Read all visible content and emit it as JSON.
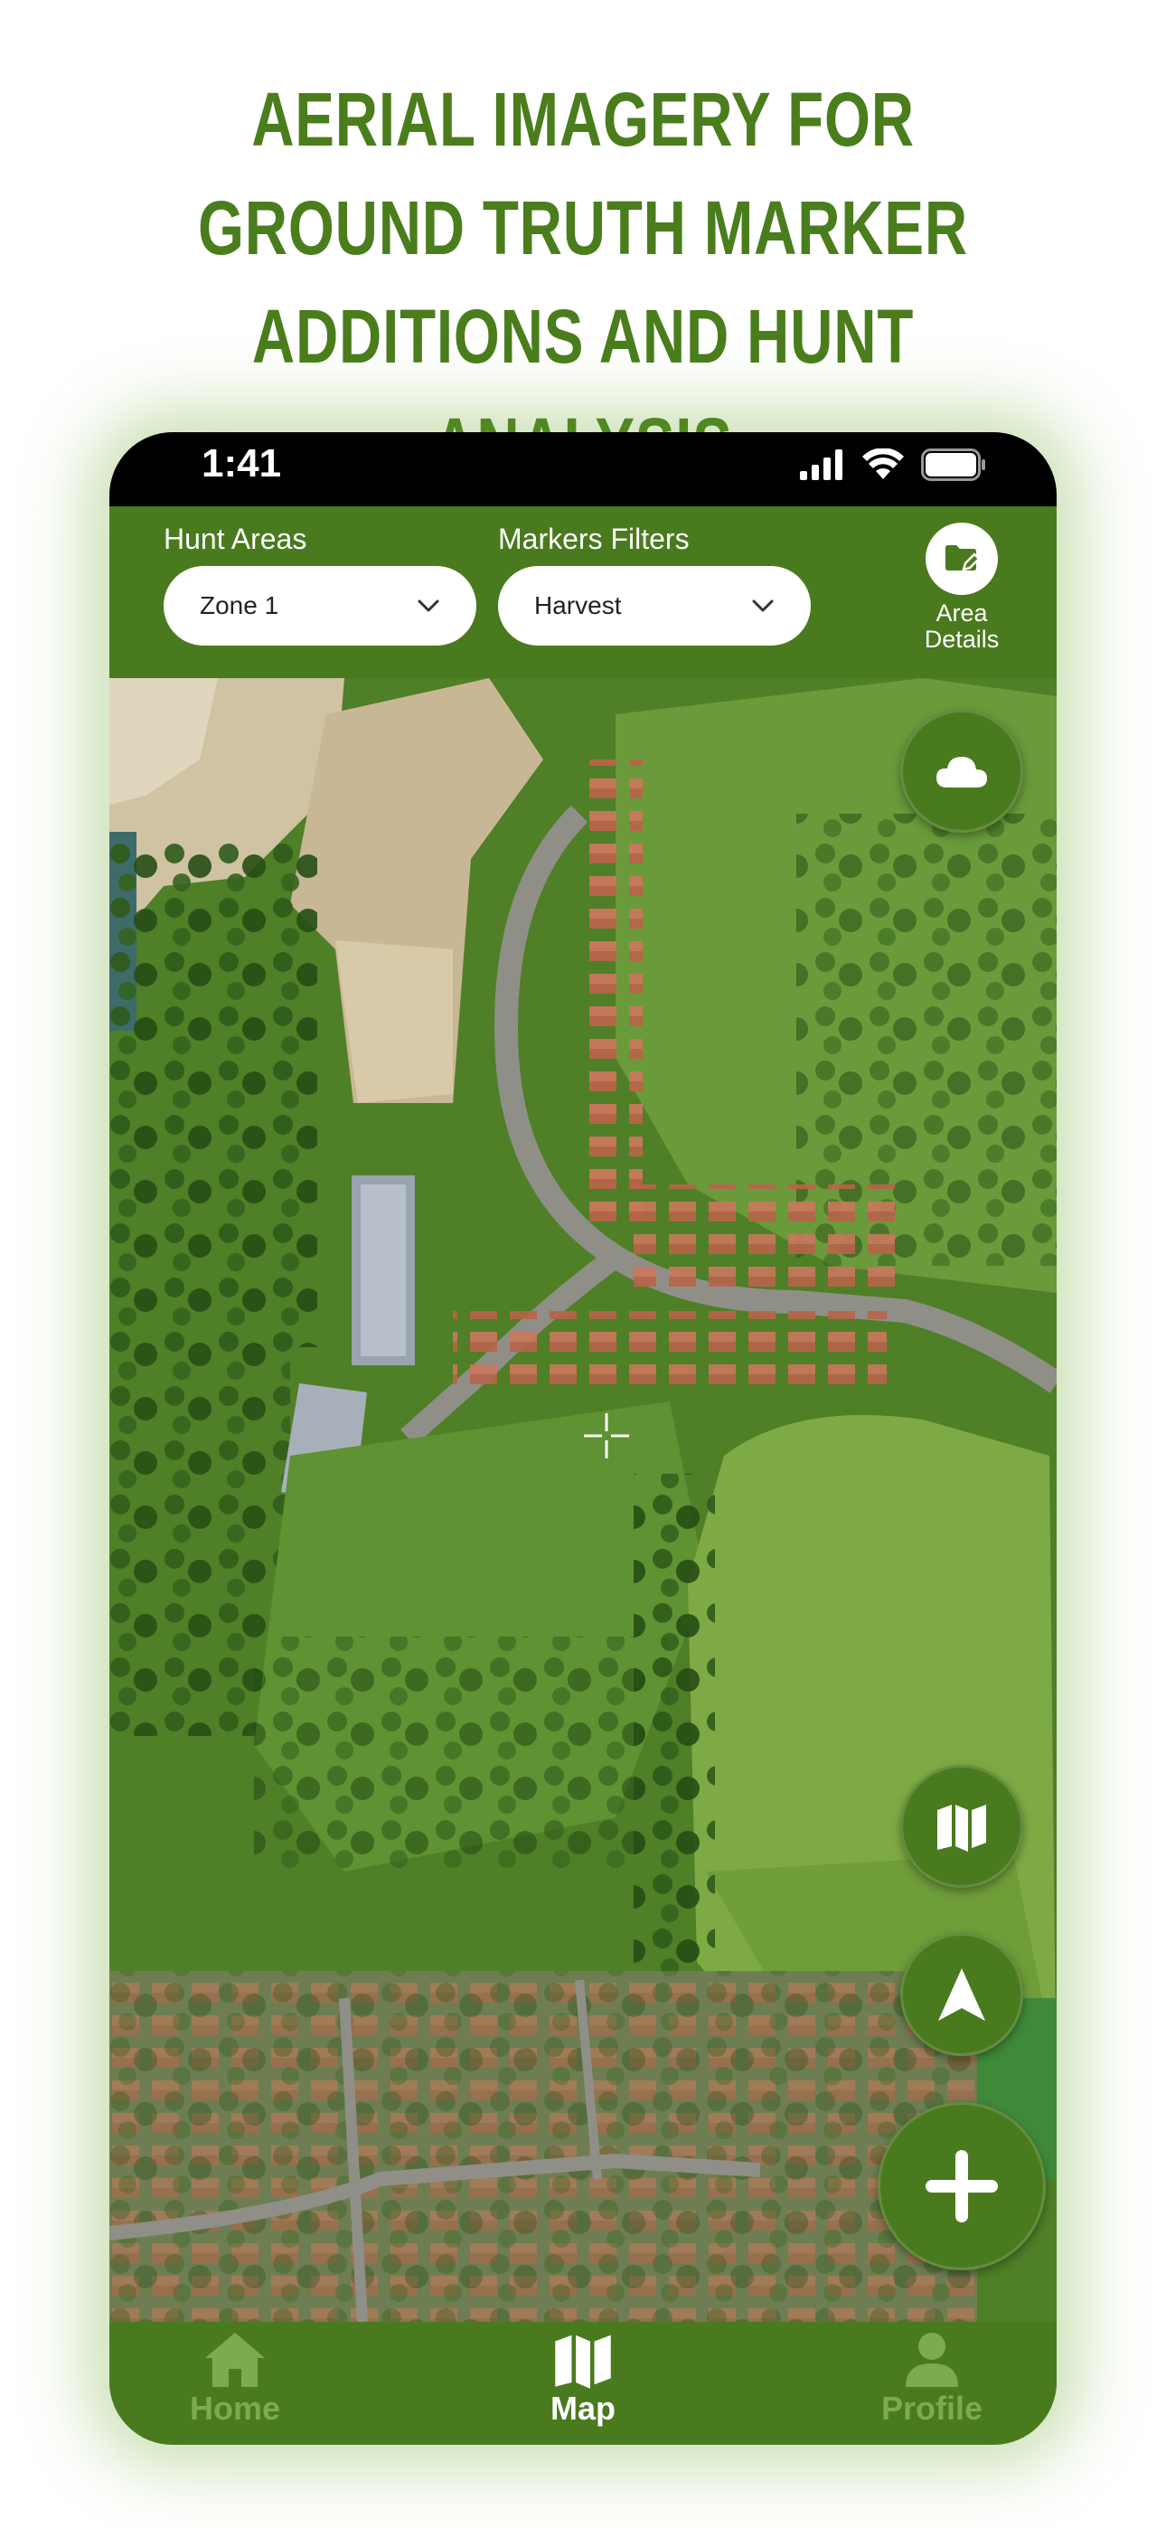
{
  "headline": "AERIAL IMAGERY FOR GROUND TRUTH MARKER ADDITIONS AND HUNT ANALYSIS",
  "status_bar": {
    "time": "1:41"
  },
  "filters": {
    "hunt_areas": {
      "label": "Hunt Areas",
      "selected": "Zone 1"
    },
    "markers_filters": {
      "label": "Markers Filters",
      "selected": "Harvest"
    }
  },
  "area_details": {
    "label": "Area Details"
  },
  "map": {
    "fabs": [
      "cloud-icon",
      "map-layers-icon",
      "navigation-arrow-icon",
      "plus-icon"
    ]
  },
  "bottom_nav": {
    "items": [
      {
        "label": "Home",
        "icon": "home-icon",
        "active": false
      },
      {
        "label": "Map",
        "icon": "map-icon",
        "active": true
      },
      {
        "label": "Profile",
        "icon": "profile-icon",
        "active": false
      }
    ]
  },
  "colors": {
    "brand_green": "#4a7a1e",
    "headline_green": "#4a7d1c",
    "inactive_nav": "#7eaa4e"
  }
}
